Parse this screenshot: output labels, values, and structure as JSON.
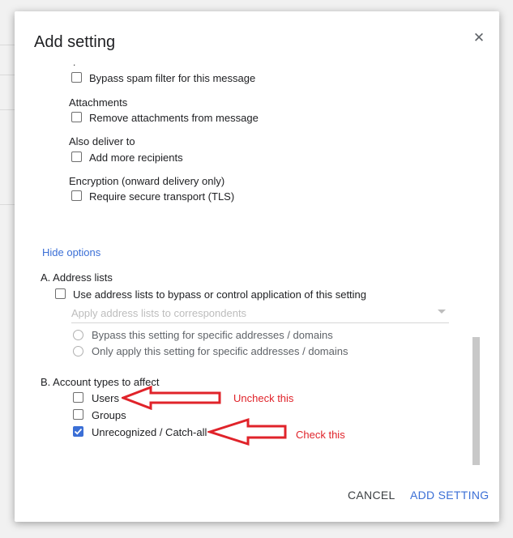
{
  "dialog": {
    "title": "Add setting",
    "close_glyph": "✕"
  },
  "sections": {
    "bypass_spam": {
      "label": "Bypass spam filter for this message",
      "checked": false
    },
    "attachments": {
      "heading": "Attachments",
      "label": "Remove attachments from message",
      "checked": false
    },
    "also_deliver": {
      "heading": "Also deliver to",
      "label": "Add more recipients",
      "checked": false
    },
    "encryption": {
      "heading": "Encryption (onward delivery only)",
      "label": "Require secure transport (TLS)",
      "checked": false
    }
  },
  "hide_options": "Hide options",
  "address_lists": {
    "heading": "A. Address lists",
    "checkbox_label": "Use address lists to bypass or control application of this setting",
    "select_placeholder": "Apply address lists to correspondents",
    "radio_bypass": "Bypass this setting for specific addresses / domains",
    "radio_only": "Only apply this setting for specific addresses / domains"
  },
  "account_types": {
    "heading": "B. Account types to affect",
    "users": {
      "label": "Users",
      "checked": false
    },
    "groups": {
      "label": "Groups",
      "checked": false
    },
    "catch_all": {
      "label": "Unrecognized / Catch-all",
      "checked": true
    }
  },
  "annotations": {
    "uncheck": "Uncheck this",
    "check": "Check this"
  },
  "footer": {
    "cancel": "CANCEL",
    "add": "ADD SETTING"
  },
  "colors": {
    "accent": "#3b6fd6",
    "annotation": "#e0232a"
  }
}
